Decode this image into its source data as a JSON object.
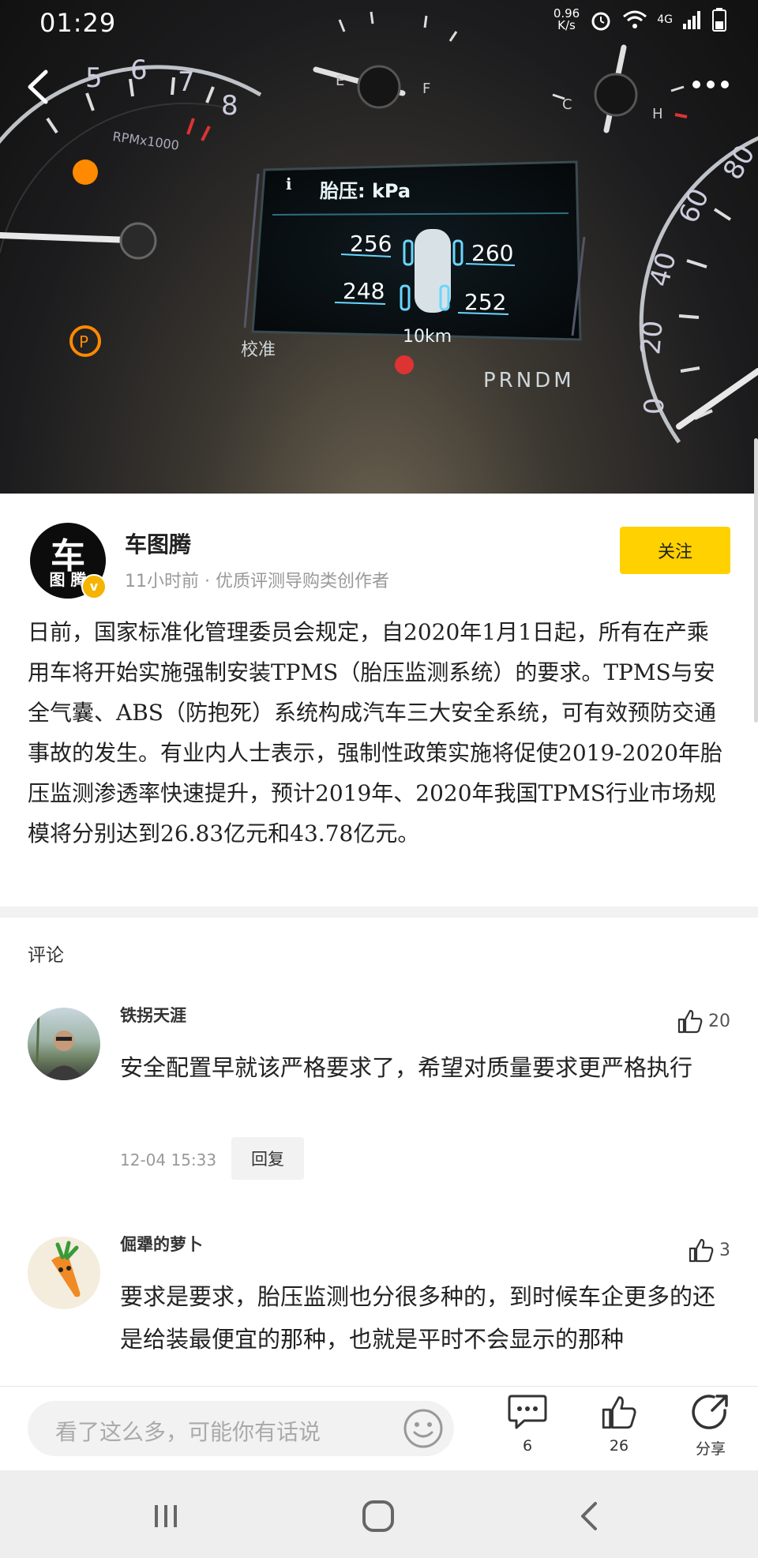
{
  "status_bar": {
    "time": "01:29",
    "net_speed": "0.96\nK/s",
    "network": "4G"
  },
  "dashboard": {
    "title": "胎压: kPa",
    "tire_front_left": "256",
    "tire_front_right": "260",
    "tire_rear_left": "248",
    "tire_rear_right": "252",
    "distance": "10km",
    "calibrate": "校准",
    "gear": "PRNDM",
    "tach_label": "RPMx1000",
    "tach_numbers": [
      "5",
      "6",
      "7",
      "8"
    ],
    "speed_numbers": [
      "80",
      "60",
      "40",
      "20",
      "0"
    ],
    "fuel_e": "E",
    "fuel_f": "F",
    "temp_c": "C",
    "temp_h": "H"
  },
  "author": {
    "avatar_char1": "车",
    "avatar_char2": "图 腾",
    "badge": "v",
    "name": "车图腾",
    "meta": "11小时前 · 优质评测导购类创作者",
    "follow_label": "关注"
  },
  "article": {
    "text": "日前，国家标准化管理委员会规定，自2020年1月1日起，所有在产乘用车将开始实施强制安装TPMS（胎压监测系统）的要求。TPMS与安全气囊、ABS（防抱死）系统构成汽车三大安全系统，可有效预防交通事故的发生。有业内人士表示，强制性政策实施将促使2019-2020年胎压监测渗透率快速提升，预计2019年、2020年我国TPMS行业市场规模将分别达到26.83亿元和43.78亿元。"
  },
  "comments": {
    "title": "评论",
    "items": [
      {
        "name": "铁拐天涯",
        "likes": "20",
        "text": "安全配置早就该严格要求了，希望对质量要求更严格执行",
        "time": "12-04 15:33",
        "reply_label": "回复"
      },
      {
        "name": "倔犟的萝卜",
        "likes": "3",
        "text": "要求是要求，胎压监测也分很多种的，到时候车企更多的还是给装最便宜的那种，也就是平时不会显示的那种"
      }
    ]
  },
  "bottom_bar": {
    "input_placeholder": "看了这么多，可能你有话说",
    "comment_count": "6",
    "like_count": "26",
    "share_label": "分享"
  },
  "colors": {
    "accent": "#ffd100",
    "text": "#222222",
    "muted": "#999999",
    "cluster_glow": "#6ad6ff"
  }
}
